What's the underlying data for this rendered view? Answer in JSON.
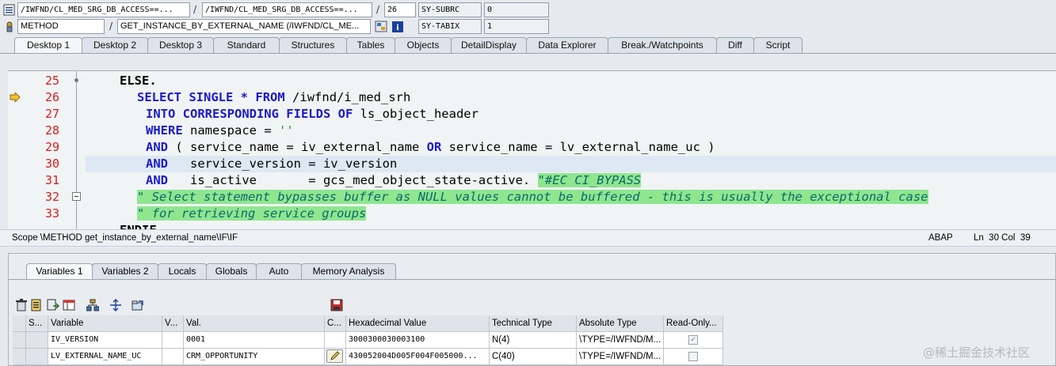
{
  "header": {
    "row1": {
      "program": "/IWFND/CL_MED_SRG_DB_ACCESS==...",
      "include": "/IWFND/CL_MED_SRG_DB_ACCESS==...",
      "line": "26",
      "sysvar_name": "SY-SUBRC",
      "sysvar_value": "0"
    },
    "row2": {
      "event_type": "METHOD",
      "event_name": "GET_INSTANCE_BY_EXTERNAL_NAME (/IWFND/CL_ME...",
      "sysvar_name": "SY-TABIX",
      "sysvar_value": "1"
    },
    "slash": "/"
  },
  "main_tabs": [
    "Desktop 1",
    "Desktop 2",
    "Desktop 3",
    "Standard",
    "Structures",
    "Tables",
    "Objects",
    "DetailDisplay",
    "Data Explorer",
    "Break./Watchpoints",
    "Diff",
    "Script"
  ],
  "editor": {
    "line_numbers": [
      "25",
      "26",
      "27",
      "28",
      "29",
      "30",
      "31",
      "32",
      "33"
    ],
    "code": {
      "l25": "ELSE.",
      "l26_kw": "SELECT SINGLE",
      "l26_star": "*",
      "l26_from": "FROM",
      "l26_rest": "/iwfnd/i_med_srh",
      "l27_kw": "INTO CORRESPONDING FIELDS OF",
      "l27_rest": "ls_object_header",
      "l28_kw": "WHERE",
      "l28_rest": "namespace = ",
      "l28_str": "''",
      "l29_kw": "AND",
      "l29_rest1": "( service_name = iv_external_name ",
      "l29_or": "OR",
      "l29_rest2": " service_name = lv_external_name_uc )",
      "l30_kw": "AND",
      "l30_rest": "   service_version = iv_version",
      "l31_kw": "AND",
      "l31_rest": "   is_active       = gcs_med_object_state-active. ",
      "l31_cmt": "\"#EC CI_BYPASS",
      "l32": "\" Select statement bypasses buffer as NULL values cannot be buffered - this is usually the exceptional case",
      "l33": "\" for retrieving service groups",
      "l34": "ENDIF."
    }
  },
  "scope_bar": {
    "scope": "Scope \\METHOD get_instance_by_external_name\\IF\\IF",
    "language": "ABAP",
    "position": "Ln  30 Col  39"
  },
  "var_tabs": [
    "Variables 1",
    "Variables 2",
    "Locals",
    "Globals",
    "Auto",
    "Memory Analysis"
  ],
  "grid": {
    "columns": [
      "S...",
      "Variable",
      "V...",
      "Val.",
      "C...",
      "Hexadecimal Value",
      "Technical Type",
      "Absolute Type",
      "Read-Only..."
    ],
    "rows": [
      {
        "variable": "IV_VERSION",
        "value": "0001",
        "hex": "3000300030003100",
        "tech": "N(4)",
        "abs": "\\TYPE=/IWFND/M...",
        "readonly": true
      },
      {
        "variable": "LV_EXTERNAL_NAME_UC",
        "value": "CRM_OPPORTUNITY",
        "hex": "430052004D005F004F005000...",
        "tech": "C(40)",
        "abs": "\\TYPE=/IWFND/M...",
        "readonly": false
      }
    ]
  },
  "watermark": "@稀土掘金技术社区",
  "colors": {
    "keyword": "#1a1acd",
    "line_number": "#d81b1b",
    "comment_bg": "#8fe68f",
    "current_line": "#dde8f3"
  }
}
